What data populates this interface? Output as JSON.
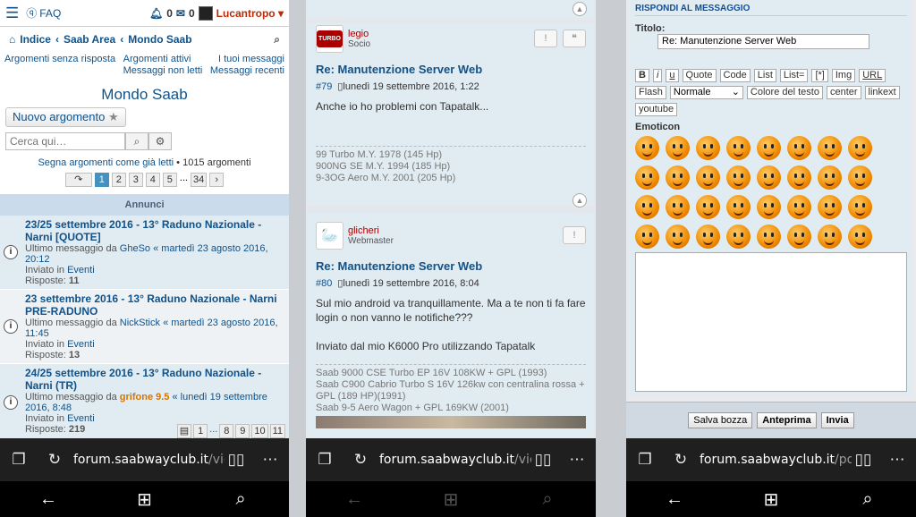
{
  "phone1": {
    "faq": "FAQ",
    "notif_count": "0",
    "msg_count": "0",
    "username": "Lucantropo ▾",
    "crumbs": [
      "Indice",
      "Saab Area",
      "Mondo Saab"
    ],
    "quick_left1": "Argomenti senza risposta",
    "quick_mid1": "Argomenti attivi",
    "quick_mid2": "Messaggi non letti",
    "quick_right1": "I tuoi messaggi",
    "quick_right2": "Messaggi recenti",
    "forum_title": "Mondo Saab",
    "new_topic": "Nuovo argomento",
    "search_placeholder": "Cerca qui…",
    "mark_read": "Segna argomenti come già letti",
    "topics_count": "• 1015 argomenti",
    "pages": [
      "1",
      "2",
      "3",
      "4",
      "5",
      "...",
      "34"
    ],
    "annunci": "Annunci",
    "topics": [
      {
        "title": "23/25 settembre 2016 - 13° Raduno Nazionale - Narni [QUOTE]",
        "last_prefix": "Ultimo messaggio da",
        "user": "GheSo",
        "date": "« martedì 23 agosto 2016, 20:12",
        "in": "Inviato in",
        "forum": "Eventi",
        "replies_label": "Risposte:",
        "replies": "11",
        "icon": "i"
      },
      {
        "title": "23 settembre 2016 - 13° Raduno Nazionale - Narni PRE-RADUNO",
        "last_prefix": "Ultimo messaggio da",
        "user": "NickStick",
        "date": "« martedì 23 agosto 2016, 11:45",
        "in": "Inviato in",
        "forum": "Eventi",
        "replies_label": "Risposte:",
        "replies": "13",
        "icon": "i"
      },
      {
        "title": "24/25 settembre 2016 - 13° Raduno Nazionale - Narni (TR)",
        "last_prefix": "Ultimo messaggio da",
        "user": "grifone 9.5",
        "date": "« lunedì 19 settembre 2016, 8:48",
        "in": "Inviato in",
        "forum": "Eventi",
        "replies_label": "Risposte:",
        "replies": "219",
        "icon": "i"
      }
    ],
    "mini_pages": [
      "1",
      "...",
      "8",
      "9",
      "10",
      "11"
    ],
    "url_host": "forum.saabwayclub.it",
    "url_path": "/vie"
  },
  "phone2": {
    "posts": [
      {
        "name": "legio",
        "rank": "Socio",
        "title": "Re: Manutenzione Server Web",
        "num": "#79",
        "date": "lunedì 19 settembre 2016, 1:22",
        "body": [
          "Anche io ho problemi con Tapatalk..."
        ],
        "sig": [
          "99 Turbo M.Y. 1978 (145 Hp)",
          "900NG SE M.Y. 1994 (185 Hp)",
          "9-3OG Aero M.Y. 2001 (205 Hp)"
        ],
        "avatar": "TURBO"
      },
      {
        "name": "glicheri",
        "rank": "Webmaster",
        "title": "Re: Manutenzione Server Web",
        "num": "#80",
        "date": "lunedì 19 settembre 2016, 8:04",
        "body": [
          "Sul mio android va tranquillamente. Ma a te non ti fa fare login o non vanno le notifiche???",
          "",
          "Inviato dal mio K6000 Pro utilizzando Tapatalk"
        ],
        "sig": [
          "Saab 9000 CSE Turbo EP 16V 108KW + GPL (1993)",
          "Saab C900 Cabrio Turbo S 16V 126kw con centralina rossa + GPL (189 HP)(1991)",
          "Saab 9-5 Aero Wagon + GPL 169KW (2001)"
        ],
        "avatar": "🦢"
      }
    ],
    "url_host": "forum.saabwayclub.it",
    "url_path": "/vie"
  },
  "phone3": {
    "heading": "RISPONDI AL MESSAGGIO",
    "title_label": "Titolo:",
    "title_value": "Re: Manutenzione Server Web",
    "buttons": [
      "B",
      "i",
      "u",
      "Quote",
      "Code",
      "List",
      "List=",
      "[*]",
      "Img",
      "URL",
      "Flash",
      "Colore del testo",
      "center",
      "linkext",
      "youtube"
    ],
    "size_select": "Normale",
    "emoticon_label": "Emoticon",
    "submit": [
      "Salva bozza",
      "Anteprima",
      "Invia"
    ],
    "url_host": "forum.saabwayclub.it",
    "url_path": "/pos"
  }
}
